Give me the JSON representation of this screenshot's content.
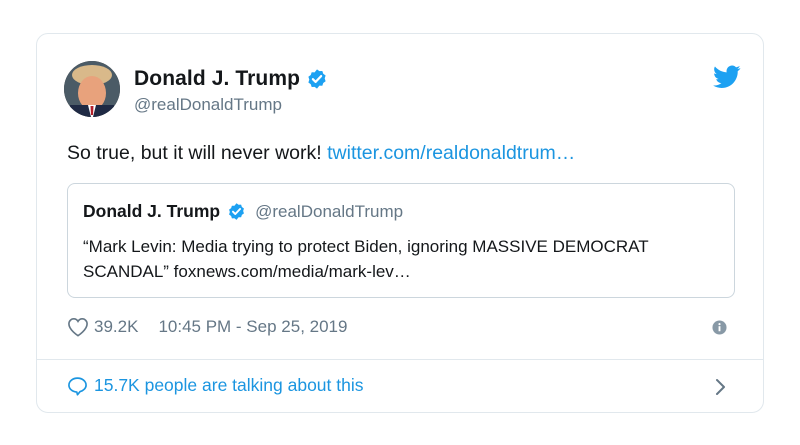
{
  "tweet": {
    "author_name": "Donald J. Trump",
    "handle": "@realDonaldTrump",
    "text": "So true, but it will never work! ",
    "link": "twitter.com/realdonaldtrum…",
    "quote": {
      "author_name": "Donald J. Trump",
      "handle": "@realDonaldTrump",
      "text": "“Mark Levin: Media trying to protect Biden, ignoring MASSIVE DEMOCRAT SCANDAL” foxnews.com/media/mark-lev…"
    },
    "likes": "39.2K",
    "timestamp": "10:45 PM - Sep 25, 2019",
    "talking": "15.7K people are talking about this"
  },
  "icons": {
    "verified": "verified-badge-icon",
    "brand": "twitter-bird-icon",
    "like": "heart-icon",
    "info": "info-icon",
    "reply": "speech-bubble-icon",
    "more": "chevron-right-icon"
  },
  "colors": {
    "accent": "#1b95e0",
    "text": "#14171a",
    "muted": "#657786",
    "border": "#e1e8ed"
  }
}
